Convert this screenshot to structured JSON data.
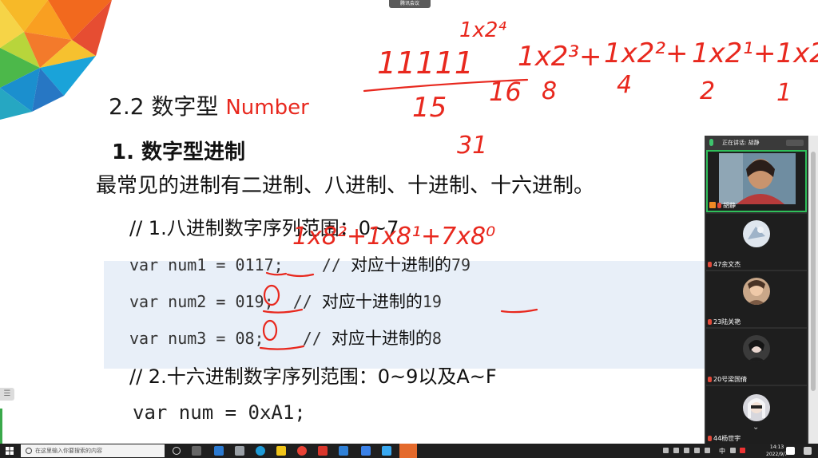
{
  "slide": {
    "section_number": "2.2 数字型 ",
    "section_name": "Number",
    "sub_title": "1. 数字型进制",
    "intro": "最常见的进制有二进制、八进制、十进制、十六进制。",
    "comment_octal": "// 1.八进制数字序列范围：0~7",
    "code_lines": [
      {
        "code": "var num1 = 0117;    // ",
        "note": "对应十进制的",
        "result": "79"
      },
      {
        "code": "var num2 = 019;  // ",
        "note": "对应十进制的",
        "result": "19"
      },
      {
        "code": "var num3 = 08;    // ",
        "note": "对应十进制的",
        "result": "8"
      }
    ],
    "comment_hex": "// 2.十六进制数字序列范围：0~9以及A~F",
    "code_hex": "var num = 0xA1;"
  },
  "handwriting": {
    "binary": "11111",
    "top_power": "1x2⁴",
    "terms": [
      "1x2³+",
      "1x2²+",
      "1x2¹+1x2⁰"
    ],
    "sum": "15",
    "place_values": [
      "16",
      "8",
      "4",
      "2",
      "1"
    ],
    "total": "31",
    "octal_expansion": "1x8²+1x8¹+7x8⁰"
  },
  "meeting": {
    "app_label": "腾讯会议",
    "speaking_label": "正在讲话: 胡静",
    "participants": [
      {
        "name": "胡静",
        "host": true
      },
      {
        "name": "47余文杰"
      },
      {
        "name": "23陆关艳"
      },
      {
        "name": "20号梁国倩"
      },
      {
        "name": "44杨世宇"
      }
    ],
    "scroll_hint": "⌄"
  },
  "taskbar": {
    "search_placeholder": "在这里输入你要搜索的内容",
    "time": "14:13",
    "date": "2022/9/7",
    "ime": "中"
  },
  "colors": {
    "accent": "#e8281e",
    "code_bg": "#e8eff8",
    "ink": "#e8281e",
    "active_border": "#2fbf5a"
  }
}
